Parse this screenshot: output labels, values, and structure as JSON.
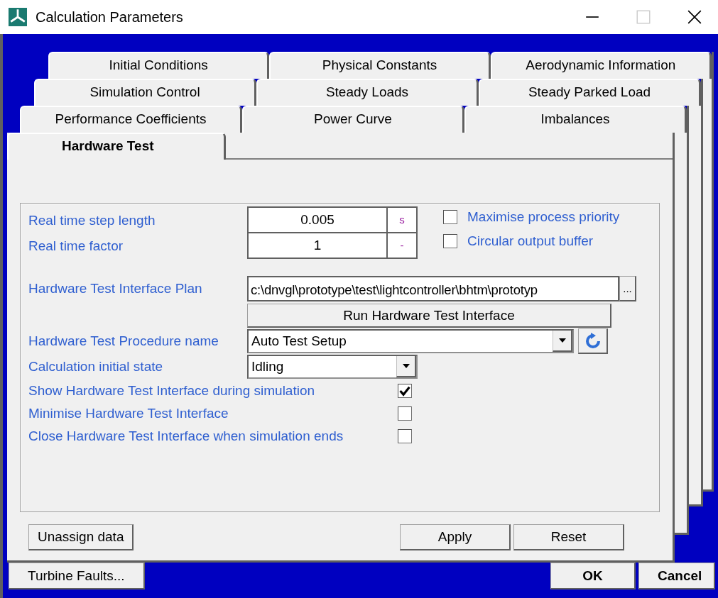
{
  "window": {
    "title": "Calculation Parameters"
  },
  "tab_rows": [
    [
      {
        "label": "Initial Conditions",
        "selected": false
      },
      {
        "label": "Physical Constants",
        "selected": false
      },
      {
        "label": "Aerodynamic Information",
        "selected": false
      }
    ],
    [
      {
        "label": "Simulation Control",
        "selected": false
      },
      {
        "label": "Steady Loads",
        "selected": false
      },
      {
        "label": "Steady Parked Load",
        "selected": false
      }
    ],
    [
      {
        "label": "Performance Coefficients",
        "selected": false
      },
      {
        "label": "Power Curve",
        "selected": false
      },
      {
        "label": "Imbalances",
        "selected": false
      }
    ],
    [
      {
        "label": "Hardware Test",
        "selected": true
      }
    ]
  ],
  "form": {
    "numeric_fields": [
      {
        "label": "Real time step length",
        "value": "0.005",
        "unit": "s"
      },
      {
        "label": "Real time factor",
        "value": "1",
        "unit": "-"
      }
    ],
    "options": [
      {
        "label": "Maximise process priority",
        "checked": false
      },
      {
        "label": "Circular output buffer",
        "checked": false
      }
    ],
    "plan": {
      "label": "Hardware Test Interface Plan",
      "value": "c:\\dnvgl\\prototype\\test\\lightcontroller\\bhtm\\prototyp",
      "browse": "..."
    },
    "run_button": "Run Hardware Test Interface",
    "procedure": {
      "label": "Hardware Test Procedure name",
      "value": "Auto Test Setup"
    },
    "initial_state": {
      "label": "Calculation initial state",
      "value": "Idling"
    },
    "flags": [
      {
        "label": "Show Hardware Test Interface during simulation",
        "checked": true
      },
      {
        "label": "Minimise Hardware Test Interface",
        "checked": false
      },
      {
        "label": "Close Hardware Test Interface when simulation ends",
        "checked": false
      }
    ]
  },
  "page_buttons": {
    "left": [
      "Unassign data"
    ],
    "right": [
      "Apply",
      "Reset"
    ]
  },
  "dialog_buttons": {
    "left": [
      "Turbine Faults..."
    ],
    "right": [
      "OK",
      "Cancel"
    ]
  }
}
